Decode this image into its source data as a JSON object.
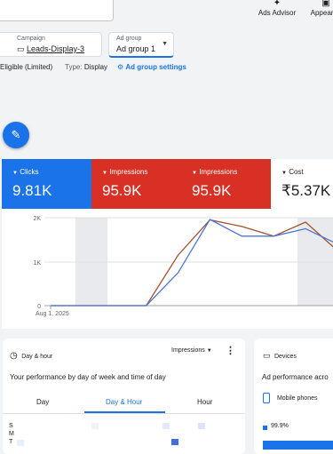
{
  "toolbar": {
    "ads_advisor": "Ads Advisor",
    "appearance": "Appearan"
  },
  "selectors": {
    "campaign_label": "Campaign",
    "campaign_value": "Leads-Display-3",
    "adgroup_label": "Ad group",
    "adgroup_value": "Ad group 1"
  },
  "status": {
    "eligibility": "Eligible (Limited)",
    "type_label": "Type:",
    "type_value": "Display",
    "settings_link": "Ad group settings"
  },
  "metrics": [
    {
      "label": "Clicks",
      "value": "9.81K"
    },
    {
      "label": "Impressions",
      "value": "95.9K"
    },
    {
      "label": "Impressions",
      "value": "95.9K"
    },
    {
      "label": "Cost",
      "value": "₹5.37K"
    }
  ],
  "colors": {
    "clicks": "#1a73e8",
    "impressions": "#d93025",
    "impressions_line": "#a1522c",
    "clicks_line": "#4a74d9"
  },
  "chart_data": {
    "type": "line",
    "x_start_label": "Aug 1, 2025",
    "ytick_labels": [
      "2K",
      "1K",
      "0"
    ],
    "ylim": [
      0,
      2000
    ],
    "x": [
      0,
      1,
      2,
      3,
      4,
      5,
      6,
      7,
      8,
      9
    ],
    "series": [
      {
        "name": "Impressions",
        "values": [
          0,
          0,
          0,
          0,
          1150,
          1950,
          1800,
          1580,
          1900,
          1250
        ]
      },
      {
        "name": "Clicks",
        "values": [
          0,
          0,
          0,
          0,
          750,
          1960,
          1580,
          1580,
          1750,
          1400
        ]
      }
    ]
  },
  "dayhour_card": {
    "title": "Day & hour",
    "metric_select": "Impressions",
    "heading": "Your performance by day of week and time of day",
    "tabs": [
      "Day",
      "Day & Hour",
      "Hour"
    ],
    "active_tab": 1,
    "day_labels": [
      "S",
      "M",
      "T"
    ]
  },
  "devices_card": {
    "title": "Devices",
    "heading": "Ad performance acro",
    "legend": "Mobile phones",
    "percent": "99.9%"
  }
}
